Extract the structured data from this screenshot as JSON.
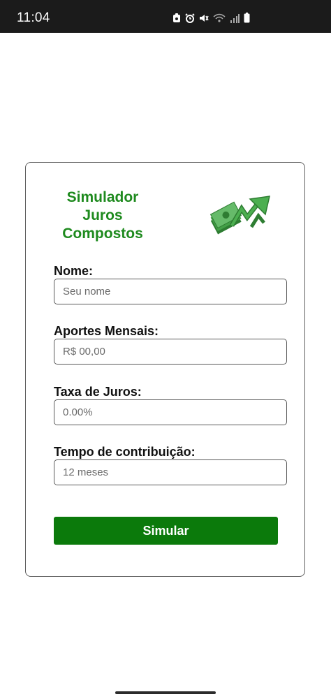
{
  "status_bar": {
    "time": "11:04",
    "icons": [
      "notification-icon",
      "alarm-icon",
      "mute-icon",
      "wifi-icon",
      "signal-icon",
      "battery-icon"
    ]
  },
  "app": {
    "title_lines": [
      "Simulador",
      "Juros",
      "Compostos"
    ],
    "logo_icon": "money-growth-icon",
    "accent_color": "#1e8a1e"
  },
  "form": {
    "fields": [
      {
        "label": "Nome:",
        "placeholder": "Seu nome",
        "value": ""
      },
      {
        "label": "Aportes Mensais:",
        "placeholder": "R$ 00,00",
        "value": ""
      },
      {
        "label": "Taxa de Juros:",
        "placeholder": "0.00%",
        "value": ""
      },
      {
        "label": "Tempo de contribuição:",
        "placeholder": "12 meses",
        "value": ""
      }
    ],
    "submit_label": "Simular",
    "button_color": "#0b7a0b"
  }
}
